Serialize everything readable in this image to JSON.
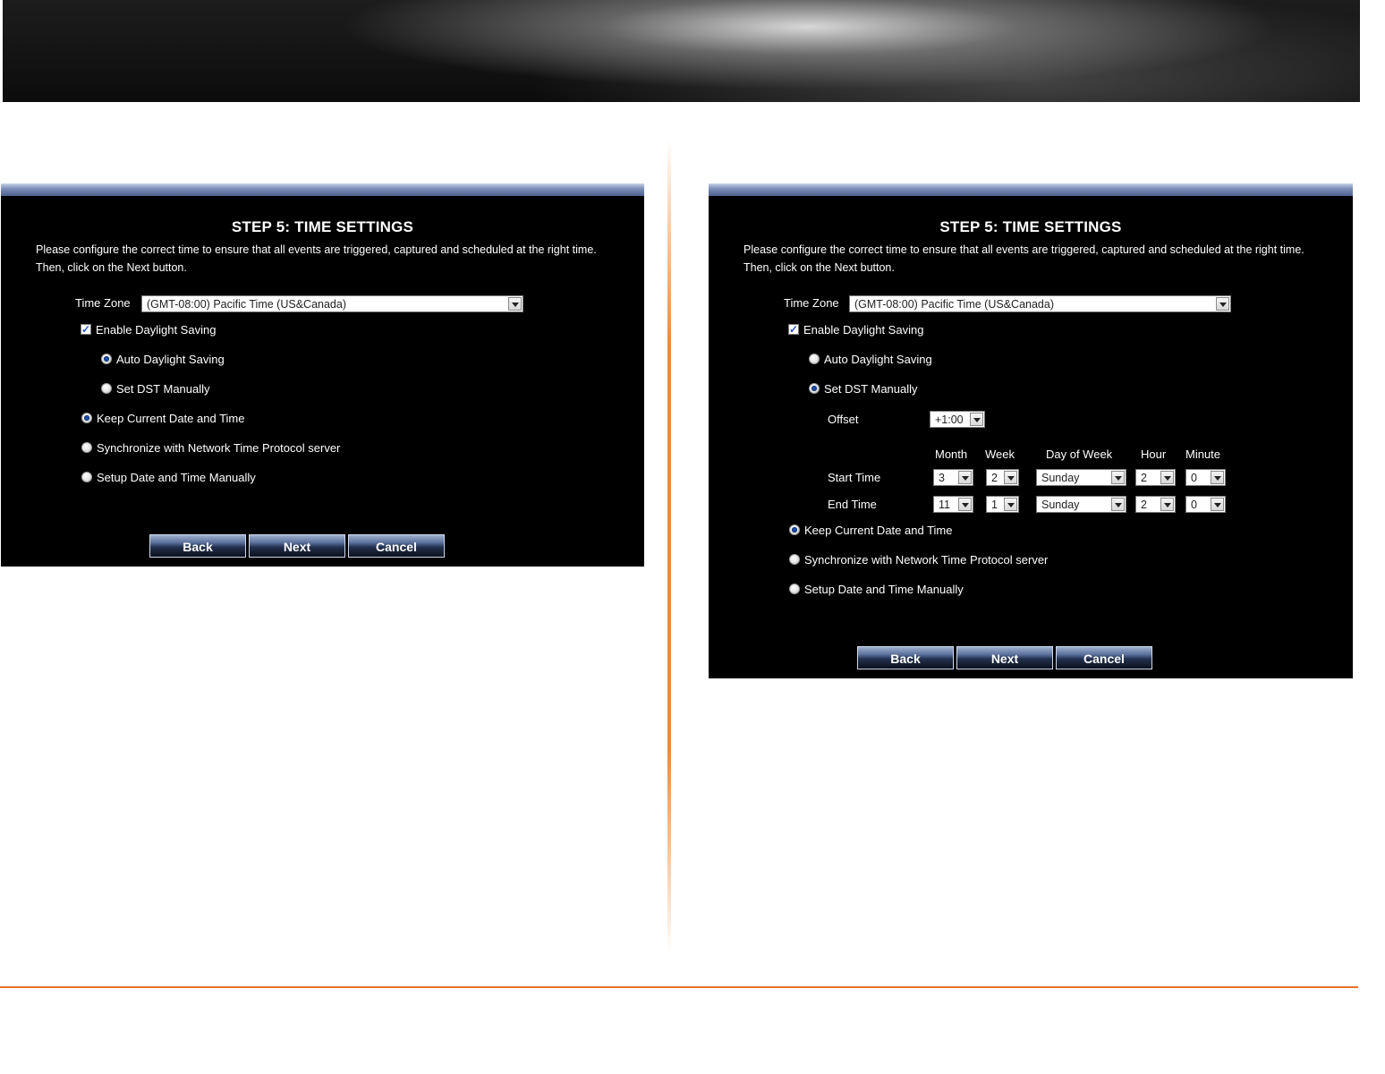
{
  "left_panel": {
    "title": "STEP 5: TIME SETTINGS",
    "description": "Please configure the correct time to ensure that all events are triggered, captured and scheduled at the right time. Then, click on the Next button.",
    "time_zone_label": "Time Zone",
    "time_zone_value": "(GMT-08:00) Pacific Time (US&Canada)",
    "enable_dst_label": "Enable Daylight Saving",
    "enable_dst_checked": true,
    "auto_dst_label": "Auto Daylight Saving",
    "manual_dst_label": "Set DST Manually",
    "dst_mode": "auto",
    "keep_label": "Keep Current Date and Time",
    "ntp_label": "Synchronize with Network Time Protocol server",
    "manual_label": "Setup Date and Time Manually",
    "time_mode": "keep",
    "buttons": {
      "back": "Back",
      "next": "Next",
      "cancel": "Cancel"
    }
  },
  "right_panel": {
    "title": "STEP 5: TIME SETTINGS",
    "description": "Please configure the correct time to ensure that all events are triggered, captured and scheduled at the right time. Then, click on the Next button.",
    "time_zone_label": "Time Zone",
    "time_zone_value": "(GMT-08:00) Pacific Time (US&Canada)",
    "enable_dst_label": "Enable Daylight Saving",
    "enable_dst_checked": true,
    "auto_dst_label": "Auto Daylight Saving",
    "manual_dst_label": "Set DST Manually",
    "dst_mode": "manual",
    "offset_label": "Offset",
    "offset_value": "+1:00",
    "columns": {
      "month": "Month",
      "week": "Week",
      "day": "Day of Week",
      "hour": "Hour",
      "minute": "Minute"
    },
    "start": {
      "label": "Start Time",
      "month": "3",
      "week": "2",
      "day": "Sunday",
      "hour": "2",
      "minute": "0"
    },
    "end": {
      "label": "End Time",
      "month": "11",
      "week": "1",
      "day": "Sunday",
      "hour": "2",
      "minute": "0"
    },
    "keep_label": "Keep Current Date and Time",
    "ntp_label": "Synchronize with Network Time Protocol server",
    "manual_label": "Setup Date and Time Manually",
    "time_mode": "keep",
    "buttons": {
      "back": "Back",
      "next": "Next",
      "cancel": "Cancel"
    }
  },
  "colors": {
    "accent_orange": "#e8712a",
    "panel_bg": "#000000",
    "radio_selected": "#1f4fa8"
  }
}
